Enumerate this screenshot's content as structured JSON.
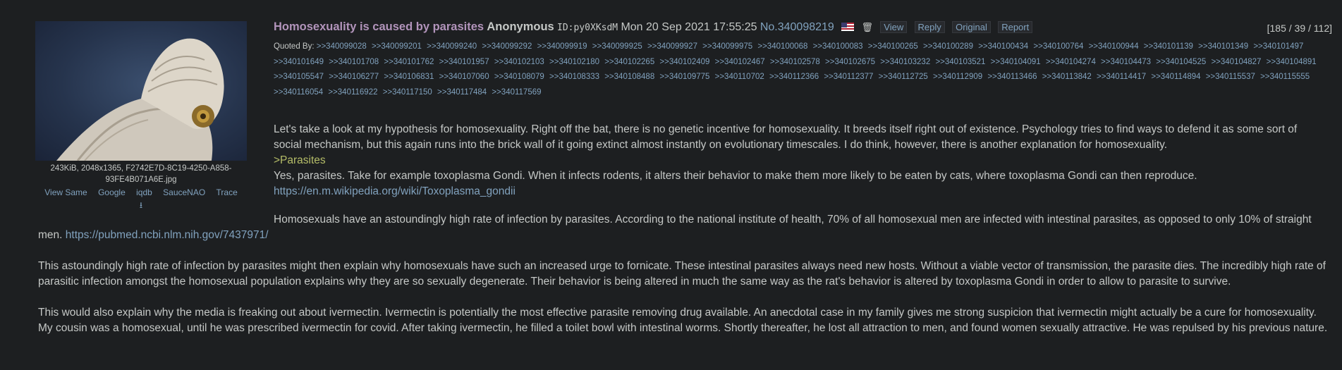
{
  "post": {
    "subject": "Homosexuality is caused by parasites",
    "name": "Anonymous",
    "id_label": "ID:",
    "id_value": "py0XKsdM",
    "datetime": "Mon 20 Sep 2021 17:55:25",
    "no_label": "No.",
    "number": "340098219",
    "flag": "us-flag-icon",
    "buttons": [
      "View",
      "Reply",
      "Original",
      "Report"
    ],
    "counter": "[185 / 39 / 112]"
  },
  "file": {
    "info": "243KiB, 2048x1365, F2742E7D-8C19-4250-A858-93FE4B071A6E.jpg",
    "links": [
      "View Same",
      "Google",
      "iqdb",
      "SauceNAO",
      "Trace"
    ],
    "download_icon": "download-icon"
  },
  "quoted_by_label": "Quoted By:",
  "quoted_by": [
    ">>340099028",
    ">>340099201",
    ">>340099240",
    ">>340099292",
    ">>340099919",
    ">>340099925",
    ">>340099927",
    ">>340099975",
    ">>340100068",
    ">>340100083",
    ">>340100265",
    ">>340100289",
    ">>340100434",
    ">>340100764",
    ">>340100944",
    ">>340101139",
    ">>340101349",
    ">>340101497",
    ">>340101649",
    ">>340101708",
    ">>340101762",
    ">>340101957",
    ">>340102103",
    ">>340102180",
    ">>340102265",
    ">>340102409",
    ">>340102467",
    ">>340102578",
    ">>340102675",
    ">>340103232",
    ">>340103521",
    ">>340104091",
    ">>340104274",
    ">>340104473",
    ">>340104525",
    ">>340104827",
    ">>340104891",
    ">>340105547",
    ">>340106277",
    ">>340106831",
    ">>340107060",
    ">>340108079",
    ">>340108333",
    ">>340108488",
    ">>340109775",
    ">>340110702",
    ">>340112366",
    ">>340112377",
    ">>340112725",
    ">>340112909",
    ">>340113466",
    ">>340113842",
    ">>340114417",
    ">>340114894",
    ">>340115537",
    ">>340115555",
    ">>340116054",
    ">>340116922",
    ">>340117150",
    ">>340117484",
    ">>340117569"
  ],
  "body": {
    "p1": "Let's take a look at my hypothesis for homosexuality. Right off the bat, there is no genetic incentive for homosexuality. It breeds itself right out of existence. Psychology tries to find ways to defend it as some sort of social mechanism, but this again runs into the brick wall of it going extinct almost instantly on evolutionary timescales. I do think, however, there is another explanation for homosexuality.",
    "greentext": ">Parasites",
    "p2": "Yes, parasites. Take for example toxoplasma Gondi. When it infects rodents, it alters their behavior to make them more likely to be eaten by cats, where toxoplasma Gondi can then reproduce.",
    "link1": "https://en.m.wikipedia.org/wiki/Toxoplasma_gondii",
    "p3": "Homosexuals have an astoundingly high rate of infection by parasites. According to the national institute of health, 70% of all homosexual men are infected with intestinal parasites, as opposed to only 10% of straight men.",
    "link2": "https://pubmed.ncbi.nlm.nih.gov/7437971/",
    "p4": "This astoundingly high rate of infection by parasites might then explain why homosexuals have such an increased urge to fornicate. These intestinal parasites always need new hosts. Without a viable vector of transmission, the parasite dies. The incredibly high rate of parasitic infection amongst the homosexual population explains why they are so sexually degenerate. Their behavior is being altered in much the same way as the rat's behavior is altered by toxoplasma Gondi in order to allow to parasite to survive.",
    "p5": "This would also explain why the media is freaking out about ivermectin. Ivermectin is potentially the most effective parasite removing drug available. An anecdotal case in my family gives me strong suspicion that ivermectin might actually be a cure for homosexuality. My cousin was a homosexual, until he was prescribed ivermectin for covid. After taking ivermectin, he filled a toilet bowl with intestinal worms. Shortly thereafter, he lost all attraction to men, and found women sexually attractive. He was repulsed by his previous nature."
  }
}
